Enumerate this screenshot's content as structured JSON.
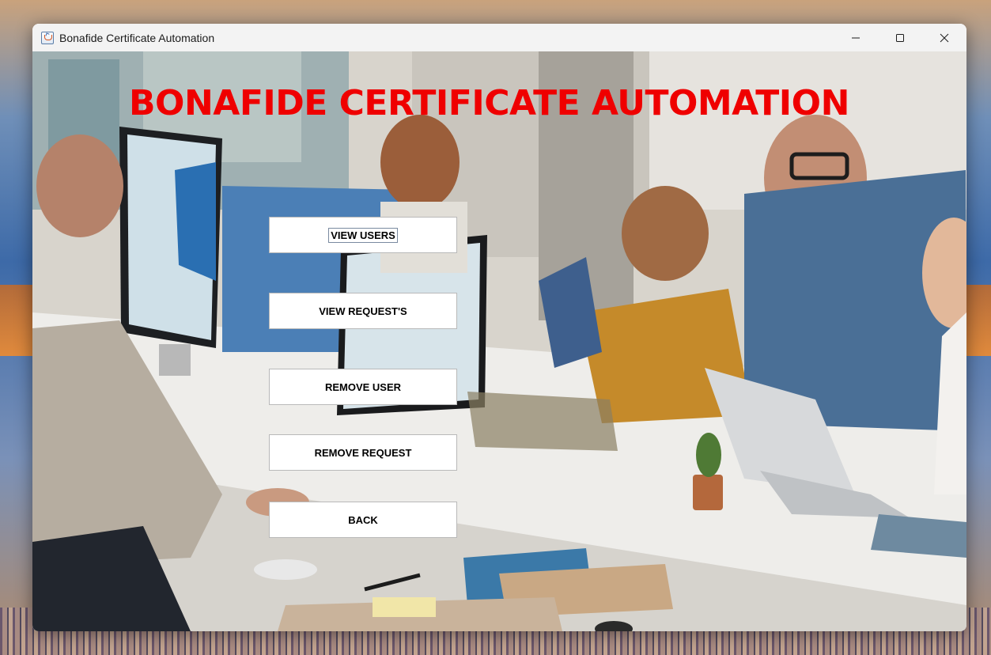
{
  "window": {
    "title": "Bonafide Certificate Automation",
    "controls": {
      "minimize": "minimize-icon",
      "maximize": "maximize-icon",
      "close": "close-icon"
    }
  },
  "main": {
    "heading": "BONAFIDE CERTIFICATE AUTOMATION",
    "buttons": [
      {
        "label": "VIEW USERS",
        "focused": true
      },
      {
        "label": "VIEW REQUEST'S",
        "focused": false
      },
      {
        "label": "REMOVE USER",
        "focused": false
      },
      {
        "label": "REMOVE REQUEST",
        "focused": false
      },
      {
        "label": "BACK",
        "focused": false
      }
    ]
  },
  "colors": {
    "heading": "#ef0000",
    "button_bg": "#ffffff",
    "titlebar_bg": "#f3f3f3"
  }
}
